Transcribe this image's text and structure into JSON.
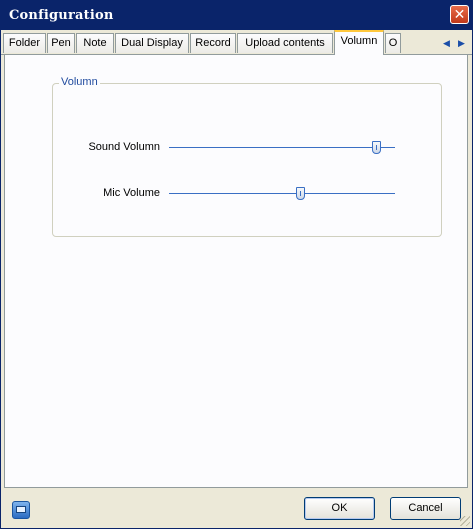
{
  "window": {
    "title": "Configuration",
    "close_glyph": "✕"
  },
  "tabs": [
    {
      "label": "Folder",
      "active": false
    },
    {
      "label": "Pen",
      "active": false
    },
    {
      "label": "Note",
      "active": false
    },
    {
      "label": "Dual Display",
      "active": false
    },
    {
      "label": "Record",
      "active": false
    },
    {
      "label": "Upload contents",
      "active": false
    },
    {
      "label": "Volumn",
      "active": true
    },
    {
      "label": "O",
      "active": false
    }
  ],
  "tab_scroll": {
    "left_glyph": "◀",
    "right_glyph": "▶"
  },
  "volume_group": {
    "legend": "Volumn",
    "sliders": [
      {
        "label": "Sound Volumn",
        "value_fraction": 0.92
      },
      {
        "label": "Mic Volume",
        "value_fraction": 0.58
      }
    ]
  },
  "footer": {
    "icon": "display-icon",
    "ok_label": "OK",
    "cancel_label": "Cancel"
  },
  "colors": {
    "titlebar": "#0a246a",
    "active_tab_accent": "#ffc83c",
    "slider": "#3a6fc4",
    "group_legend": "#1f4a9e"
  }
}
